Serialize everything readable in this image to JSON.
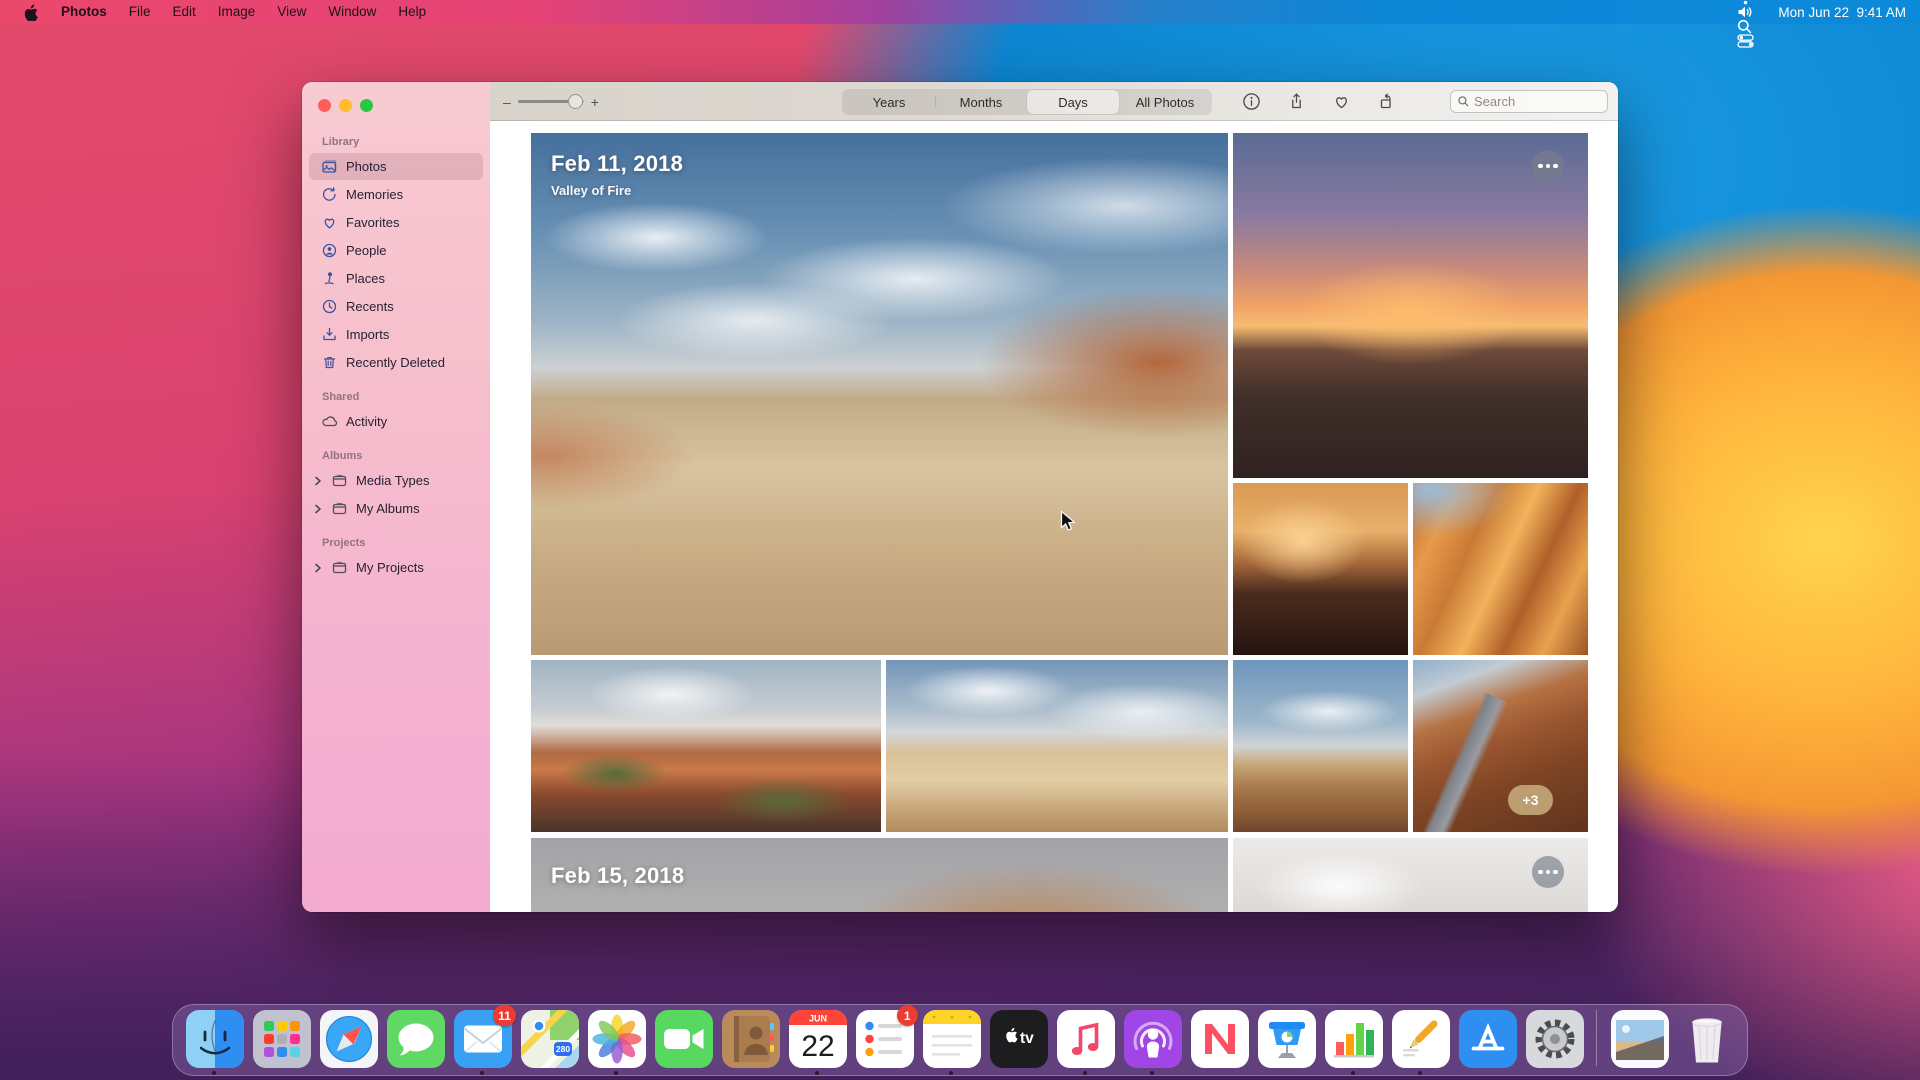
{
  "menu_bar": {
    "app_menus": [
      {
        "label": "Photos",
        "bold": true
      },
      {
        "label": "File"
      },
      {
        "label": "Edit"
      },
      {
        "label": "Image"
      },
      {
        "label": "View"
      },
      {
        "label": "Window"
      },
      {
        "label": "Help"
      }
    ],
    "status_icons": [
      {
        "icon": "screen-mirroring-icon"
      },
      {
        "icon": "wifi-icon"
      },
      {
        "icon": "volume-icon"
      },
      {
        "icon": "spotlight-icon"
      },
      {
        "icon": "control-center-icon"
      }
    ],
    "clock": "Mon Jun 22  9:41 AM"
  },
  "window": {
    "sidebar": {
      "sections": [
        {
          "title": "Library",
          "items": [
            {
              "label": "Photos",
              "icon": "photos",
              "selected": true
            },
            {
              "label": "Memories",
              "icon": "memories"
            },
            {
              "label": "Favorites",
              "icon": "heart"
            },
            {
              "label": "People",
              "icon": "people"
            },
            {
              "label": "Places",
              "icon": "places"
            },
            {
              "label": "Recents",
              "icon": "recents"
            },
            {
              "label": "Imports",
              "icon": "imports"
            },
            {
              "label": "Recently Deleted",
              "icon": "trash"
            }
          ]
        },
        {
          "title": "Shared",
          "items": [
            {
              "label": "Activity",
              "icon": "cloud",
              "dark": true
            }
          ]
        },
        {
          "title": "Albums",
          "items": [
            {
              "label": "Media Types",
              "icon": "album",
              "dark": true,
              "expandable": true
            },
            {
              "label": "My Albums",
              "icon": "album",
              "dark": true,
              "expandable": true
            }
          ]
        },
        {
          "title": "Projects",
          "items": [
            {
              "label": "My Projects",
              "icon": "album",
              "dark": true,
              "expandable": true
            }
          ]
        }
      ]
    },
    "toolbar": {
      "zoom_out": "–",
      "zoom_in": "+",
      "segments": [
        {
          "label": "Years"
        },
        {
          "label": "Months"
        },
        {
          "label": "Days",
          "selected": true
        },
        {
          "label": "All Photos"
        }
      ],
      "actions": [
        {
          "icon": "info-icon"
        },
        {
          "icon": "share-icon"
        },
        {
          "icon": "favorite-icon"
        },
        {
          "icon": "rotate-icon"
        }
      ],
      "search_placeholder": "Search"
    },
    "content": {
      "sections": [
        {
          "date": "Feb 11, 2018",
          "subtitle": "Valley of Fire",
          "overflow_badge": "+3",
          "photos": [
            {
              "id": "hero",
              "desc": "sandstone landscape under cloudy blue sky"
            },
            {
              "id": "sunset",
              "desc": "desert sunset with orange clouds"
            },
            {
              "id": "silhouette",
              "desc": "people on rocks at dusk"
            },
            {
              "id": "wave",
              "desc": "orange striped wave rock"
            },
            {
              "id": "redrocks",
              "desc": "red rocks with green shrubs"
            },
            {
              "id": "hiker",
              "desc": "hiker on pale sandstone"
            },
            {
              "id": "valley",
              "desc": "rock valley under blue sky"
            },
            {
              "id": "canyonroad",
              "desc": "road through red canyon"
            }
          ]
        },
        {
          "date": "Feb 15, 2018",
          "photos": [
            {
              "id": "blurred",
              "desc": "blurred indoor photo"
            },
            {
              "id": "sheets",
              "desc": "white crumpled fabric"
            }
          ]
        }
      ]
    }
  },
  "dock": {
    "calendar": {
      "month": "JUN",
      "day": "22"
    },
    "maps_shield": "280",
    "items": [
      {
        "name": "finder",
        "label": "Finder",
        "running": true
      },
      {
        "name": "launchpad",
        "label": "Launchpad"
      },
      {
        "name": "safari",
        "label": "Safari"
      },
      {
        "name": "messages",
        "label": "Messages"
      },
      {
        "name": "mail",
        "label": "Mail",
        "running": true,
        "badge": "11"
      },
      {
        "name": "maps",
        "label": "Maps"
      },
      {
        "name": "photos",
        "label": "Photos",
        "running": true
      },
      {
        "name": "facetime",
        "label": "FaceTime"
      },
      {
        "name": "contacts",
        "label": "Contacts"
      },
      {
        "name": "calendar",
        "label": "Calendar",
        "running": true
      },
      {
        "name": "reminders",
        "label": "Reminders",
        "badge": "1"
      },
      {
        "name": "notes",
        "label": "Notes",
        "running": true
      },
      {
        "name": "tv",
        "label": "TV"
      },
      {
        "name": "music",
        "label": "Music",
        "running": true
      },
      {
        "name": "podcasts",
        "label": "Podcasts",
        "running": true
      },
      {
        "name": "news",
        "label": "News"
      },
      {
        "name": "keynote",
        "label": "Keynote"
      },
      {
        "name": "numbers",
        "label": "Numbers",
        "running": true
      },
      {
        "name": "pages",
        "label": "Pages",
        "running": true
      },
      {
        "name": "appstore",
        "label": "App Store"
      },
      {
        "name": "settings",
        "label": "System Preferences"
      },
      {
        "divider": true
      },
      {
        "name": "picture",
        "label": "Picture"
      },
      {
        "name": "trash",
        "label": "Trash"
      }
    ]
  },
  "colors": {
    "accent_blue": "#0d86d2",
    "sidebar_icon_blue": "#3c53a4",
    "badge_red": "#ec3b30",
    "overflow_badge_tan": "#c2a678",
    "traffic_red": "#ff5f57",
    "traffic_yellow": "#febc2e",
    "traffic_green": "#28c840"
  }
}
